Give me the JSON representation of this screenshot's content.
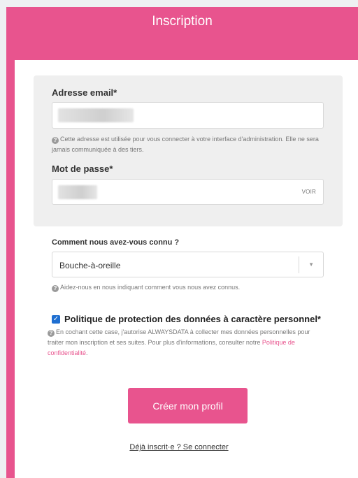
{
  "header": {
    "title": "Inscription"
  },
  "email": {
    "label": "Adresse email*",
    "help": "Cette adresse est utilisée pour vous connecter à votre interface d'administration. Elle ne sera jamais communiquée à des tiers."
  },
  "password": {
    "label": "Mot de passe*",
    "reveal_label": "VOIR"
  },
  "source": {
    "label": "Comment nous avez-vous connu ?",
    "selected": "Bouche-à-oreille",
    "help": "Aidez-nous en nous indiquant comment vous nous avez connus."
  },
  "privacy": {
    "checked": true,
    "title": "Politique de protection des données à caractère personnel*",
    "help": "En cochant cette case, j'autorise ALWAYSDATA à collecter mes données personnelles pour traiter mon inscription et ses suites. Pour plus d'informations, consulter notre",
    "link": "Politique de confidentialité",
    "help_end": "."
  },
  "submit_label": "Créer mon profil",
  "signin_link": "Déjà inscrit·e ? Se connecter",
  "colors": {
    "brand": "#e8548e",
    "checkbox": "#1f6fd1"
  }
}
